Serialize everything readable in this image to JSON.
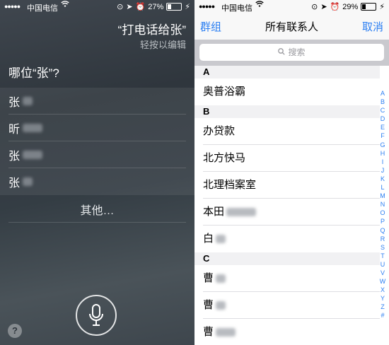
{
  "siri": {
    "status": {
      "signal": "●●●●●",
      "carrier": "中国电信",
      "wifi": "wifi-icon",
      "battery_pct": "27%",
      "battery_level": 0.27
    },
    "query": "“打电话给张”",
    "edit_hint": "轻按以编辑",
    "prompt": "哪位“张”?",
    "candidates": [
      {
        "prefix": "张"
      },
      {
        "prefix": "昕"
      },
      {
        "prefix": "张"
      },
      {
        "prefix": "张"
      }
    ],
    "other_label": "其他…",
    "help_label": "?"
  },
  "contacts": {
    "status": {
      "signal": "●●●●●",
      "carrier": "中国电信",
      "wifi": "wifi-icon",
      "battery_pct": "29%",
      "battery_level": 0.29
    },
    "nav": {
      "left": "群组",
      "title": "所有联系人",
      "right": "取消"
    },
    "search_placeholder": "搜索",
    "sections": [
      {
        "letter": "A",
        "rows": [
          {
            "name": "奥普浴霸"
          }
        ]
      },
      {
        "letter": "B",
        "rows": [
          {
            "name": "办贷款"
          },
          {
            "name": "北方快马"
          },
          {
            "name": "北理档案室"
          },
          {
            "name": "本田"
          },
          {
            "name": "白"
          }
        ]
      },
      {
        "letter": "C",
        "rows": [
          {
            "name": "曹"
          },
          {
            "name": "曹"
          },
          {
            "name": "曹"
          }
        ]
      }
    ],
    "index": [
      "A",
      "B",
      "C",
      "D",
      "E",
      "F",
      "G",
      "H",
      "I",
      "J",
      "K",
      "L",
      "M",
      "N",
      "O",
      "P",
      "Q",
      "R",
      "S",
      "T",
      "U",
      "V",
      "W",
      "X",
      "Y",
      "Z",
      "#"
    ]
  }
}
